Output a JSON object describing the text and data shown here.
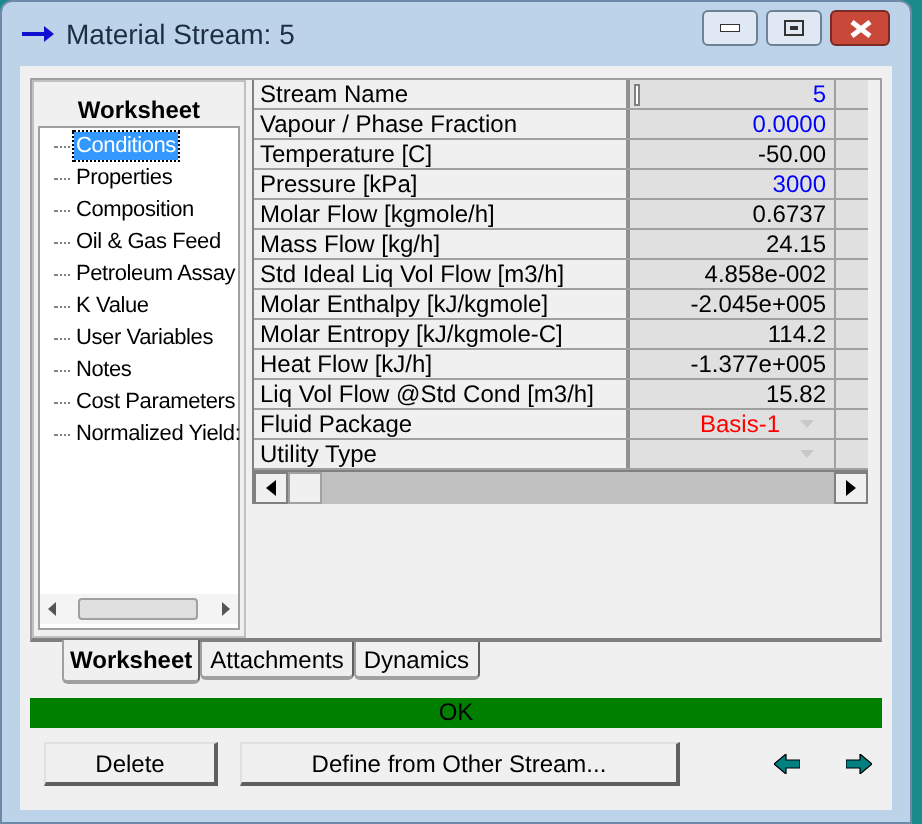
{
  "window": {
    "title": "Material Stream: 5"
  },
  "sidebar": {
    "title": "Worksheet",
    "items": [
      {
        "label": "Conditions",
        "selected": true
      },
      {
        "label": "Properties",
        "selected": false
      },
      {
        "label": "Composition",
        "selected": false
      },
      {
        "label": "Oil & Gas Feed",
        "selected": false
      },
      {
        "label": "Petroleum Assay",
        "selected": false
      },
      {
        "label": "K Value",
        "selected": false
      },
      {
        "label": "User Variables",
        "selected": false
      },
      {
        "label": "Notes",
        "selected": false
      },
      {
        "label": "Cost Parameters",
        "selected": false
      },
      {
        "label": "Normalized Yield:",
        "selected": false
      }
    ]
  },
  "table": {
    "rows": [
      {
        "label": "Stream Name",
        "value": "5",
        "color": "#0000ff",
        "kind": "text",
        "focused": true
      },
      {
        "label": "Vapour / Phase Fraction",
        "value": "0.0000",
        "color": "#0000ff",
        "kind": "text",
        "focused": false
      },
      {
        "label": "Temperature [C]",
        "value": "-50.00",
        "color": "#000000",
        "kind": "text",
        "focused": false
      },
      {
        "label": "Pressure [kPa]",
        "value": "3000",
        "color": "#0000ff",
        "kind": "text",
        "focused": false
      },
      {
        "label": "Molar Flow [kgmole/h]",
        "value": "0.6737",
        "color": "#000000",
        "kind": "text",
        "focused": false
      },
      {
        "label": "Mass Flow [kg/h]",
        "value": "24.15",
        "color": "#000000",
        "kind": "text",
        "focused": false
      },
      {
        "label": "Std Ideal Liq Vol Flow [m3/h]",
        "value": "4.858e-002",
        "color": "#000000",
        "kind": "text",
        "focused": false
      },
      {
        "label": "Molar Enthalpy [kJ/kgmole]",
        "value": "-2.045e+005",
        "color": "#000000",
        "kind": "text",
        "focused": false
      },
      {
        "label": "Molar Entropy [kJ/kgmole-C]",
        "value": "114.2",
        "color": "#000000",
        "kind": "text",
        "focused": false
      },
      {
        "label": "Heat Flow [kJ/h]",
        "value": "-1.377e+005",
        "color": "#000000",
        "kind": "text",
        "focused": false
      },
      {
        "label": "Liq Vol Flow @Std Cond [m3/h]",
        "value": "15.82",
        "color": "#000000",
        "kind": "text",
        "focused": false
      },
      {
        "label": "Fluid Package",
        "value": "Basis-1",
        "color": "#ff0000",
        "kind": "dropdown",
        "focused": false
      },
      {
        "label": "Utility Type",
        "kind": "dropdown",
        "focused": false
      }
    ]
  },
  "tabs": [
    {
      "label": "Worksheet",
      "selected": true
    },
    {
      "label": "Attachments",
      "selected": false
    },
    {
      "label": "Dynamics",
      "selected": false
    }
  ],
  "status_bar": {
    "text": "OK"
  },
  "buttons": [
    "Delete",
    "Define from Other Stream..."
  ]
}
